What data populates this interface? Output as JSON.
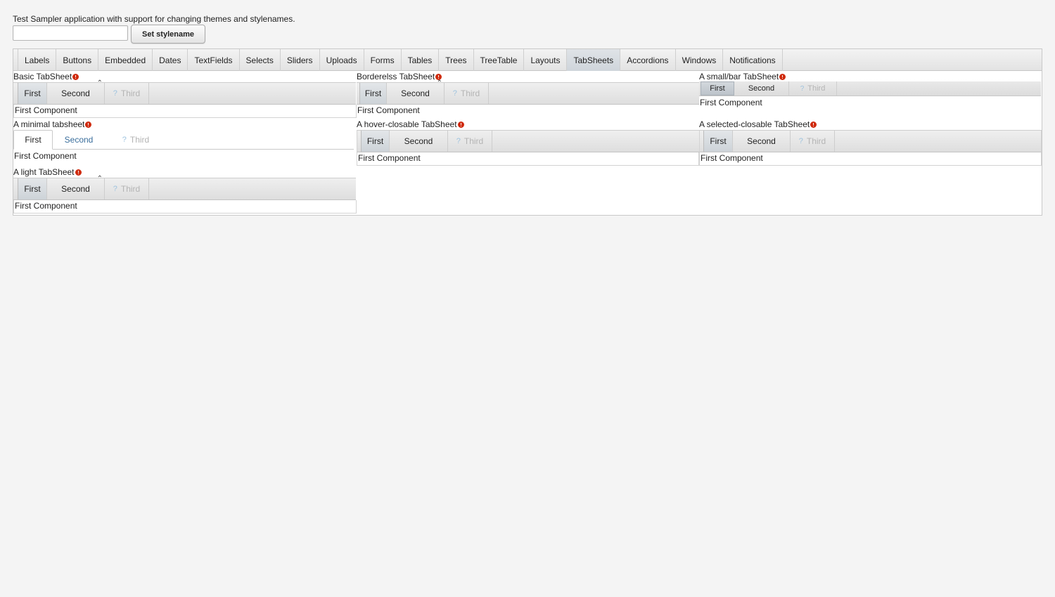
{
  "header": {
    "description": "Test Sampler application with support for changing themes and stylenames.",
    "stylename_input_value": "",
    "set_stylename_label": "Set stylename"
  },
  "main_tabs": [
    "Labels",
    "Buttons",
    "Embedded",
    "Dates",
    "TextFields",
    "Selects",
    "Sliders",
    "Uploads",
    "Forms",
    "Tables",
    "Trees",
    "TreeTable",
    "Layouts",
    "TabSheets",
    "Accordions",
    "Windows",
    "Notifications"
  ],
  "main_active_tab": "TabSheets",
  "sections": {
    "basic": {
      "caption": "Basic TabSheet",
      "tabs": [
        "First",
        "Second",
        "Third"
      ],
      "content": "First Component"
    },
    "borderless": {
      "caption": "Borderelss TabSheet",
      "tabs": [
        "First",
        "Second",
        "Third"
      ],
      "content": "First Component"
    },
    "smallbar": {
      "caption": "A small/bar TabSheet",
      "tabs": [
        "First",
        "Second",
        "Third"
      ],
      "content": "First Component"
    },
    "minimal": {
      "caption": "A minimal tabsheet",
      "tabs": [
        "First",
        "Second",
        "Third"
      ],
      "content": "First Component"
    },
    "hover_closable": {
      "caption": "A hover-closable TabSheet",
      "tabs": [
        "First",
        "Second",
        "Third"
      ],
      "content": "First Component"
    },
    "selected_closable": {
      "caption": "A selected-closable TabSheet",
      "tabs": [
        "First",
        "Second",
        "Third"
      ],
      "content": "First Component"
    },
    "light": {
      "caption": "A light TabSheet",
      "tabs": [
        "First",
        "Second",
        "Third"
      ],
      "content": "First Component"
    }
  },
  "icons": {
    "required": "required-error-icon",
    "disabled_tab": "question-icon",
    "scroll": "caret-up-icon"
  },
  "colors": {
    "required": "#cf2a0e",
    "link_tab": "#3a6e9c",
    "disabled": "#b4b4b4"
  }
}
